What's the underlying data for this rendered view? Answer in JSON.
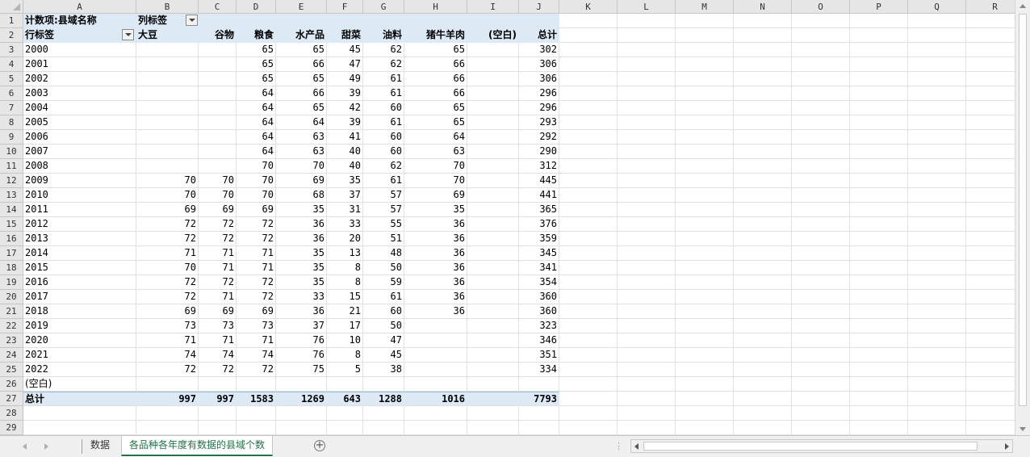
{
  "columns": [
    "A",
    "B",
    "C",
    "D",
    "E",
    "F",
    "G",
    "H",
    "I",
    "J",
    "K",
    "L",
    "M",
    "N",
    "O",
    "P",
    "Q",
    "R"
  ],
  "rows": [
    "1",
    "2",
    "3",
    "4",
    "5",
    "6",
    "7",
    "8",
    "9",
    "10",
    "11",
    "12",
    "13",
    "14",
    "15",
    "16",
    "17",
    "18",
    "19",
    "20",
    "21",
    "22",
    "23",
    "24",
    "25",
    "26",
    "27",
    "28",
    "29"
  ],
  "pivot": {
    "r1": {
      "a": "计数项:县域名称",
      "b": "列标签"
    },
    "r2": {
      "a": "行标签",
      "b": "大豆",
      "c": "谷物",
      "d": "粮食",
      "e": "水产品",
      "f": "甜菜",
      "g": "油料",
      "h": "猪牛羊肉",
      "i": "(空白)",
      "j": "总计"
    },
    "data": [
      [
        "2000",
        "",
        "",
        "65",
        "65",
        "45",
        "62",
        "65",
        "",
        "302"
      ],
      [
        "2001",
        "",
        "",
        "65",
        "66",
        "47",
        "62",
        "66",
        "",
        "306"
      ],
      [
        "2002",
        "",
        "",
        "65",
        "65",
        "49",
        "61",
        "66",
        "",
        "306"
      ],
      [
        "2003",
        "",
        "",
        "64",
        "66",
        "39",
        "61",
        "66",
        "",
        "296"
      ],
      [
        "2004",
        "",
        "",
        "64",
        "65",
        "42",
        "60",
        "65",
        "",
        "296"
      ],
      [
        "2005",
        "",
        "",
        "64",
        "64",
        "39",
        "61",
        "65",
        "",
        "293"
      ],
      [
        "2006",
        "",
        "",
        "64",
        "63",
        "41",
        "60",
        "64",
        "",
        "292"
      ],
      [
        "2007",
        "",
        "",
        "64",
        "63",
        "40",
        "60",
        "63",
        "",
        "290"
      ],
      [
        "2008",
        "",
        "",
        "70",
        "70",
        "40",
        "62",
        "70",
        "",
        "312"
      ],
      [
        "2009",
        "70",
        "70",
        "70",
        "69",
        "35",
        "61",
        "70",
        "",
        "445"
      ],
      [
        "2010",
        "70",
        "70",
        "70",
        "68",
        "37",
        "57",
        "69",
        "",
        "441"
      ],
      [
        "2011",
        "69",
        "69",
        "69",
        "35",
        "31",
        "57",
        "35",
        "",
        "365"
      ],
      [
        "2012",
        "72",
        "72",
        "72",
        "36",
        "33",
        "55",
        "36",
        "",
        "376"
      ],
      [
        "2013",
        "72",
        "72",
        "72",
        "36",
        "20",
        "51",
        "36",
        "",
        "359"
      ],
      [
        "2014",
        "71",
        "71",
        "71",
        "35",
        "13",
        "48",
        "36",
        "",
        "345"
      ],
      [
        "2015",
        "70",
        "71",
        "71",
        "35",
        "8",
        "50",
        "36",
        "",
        "341"
      ],
      [
        "2016",
        "72",
        "72",
        "72",
        "35",
        "8",
        "59",
        "36",
        "",
        "354"
      ],
      [
        "2017",
        "72",
        "71",
        "72",
        "33",
        "15",
        "61",
        "36",
        "",
        "360"
      ],
      [
        "2018",
        "69",
        "69",
        "69",
        "36",
        "21",
        "60",
        "36",
        "",
        "360"
      ],
      [
        "2019",
        "73",
        "73",
        "73",
        "37",
        "17",
        "50",
        "",
        "",
        "323"
      ],
      [
        "2020",
        "71",
        "71",
        "71",
        "76",
        "10",
        "47",
        "",
        "",
        "346"
      ],
      [
        "2021",
        "74",
        "74",
        "74",
        "76",
        "8",
        "45",
        "",
        "",
        "351"
      ],
      [
        "2022",
        "72",
        "72",
        "72",
        "75",
        "5",
        "38",
        "",
        "",
        "334"
      ],
      [
        "(空白)",
        "",
        "",
        "",
        "",
        "",
        "",
        "",
        "",
        ""
      ]
    ],
    "total": [
      "总计",
      "997",
      "997",
      "1583",
      "1269",
      "643",
      "1288",
      "1016",
      "",
      "7793"
    ]
  },
  "sheet_tabs": [
    {
      "label": "数据",
      "active": false
    },
    {
      "label": "各品种各年度有数据的县域个数",
      "active": true
    }
  ],
  "colors": {
    "pivot_header": "#dde9f5",
    "active_tab": "#217346"
  },
  "icons": {
    "add_sheet": "plus-circle-icon",
    "filter": "dropdown-filter-icon"
  }
}
